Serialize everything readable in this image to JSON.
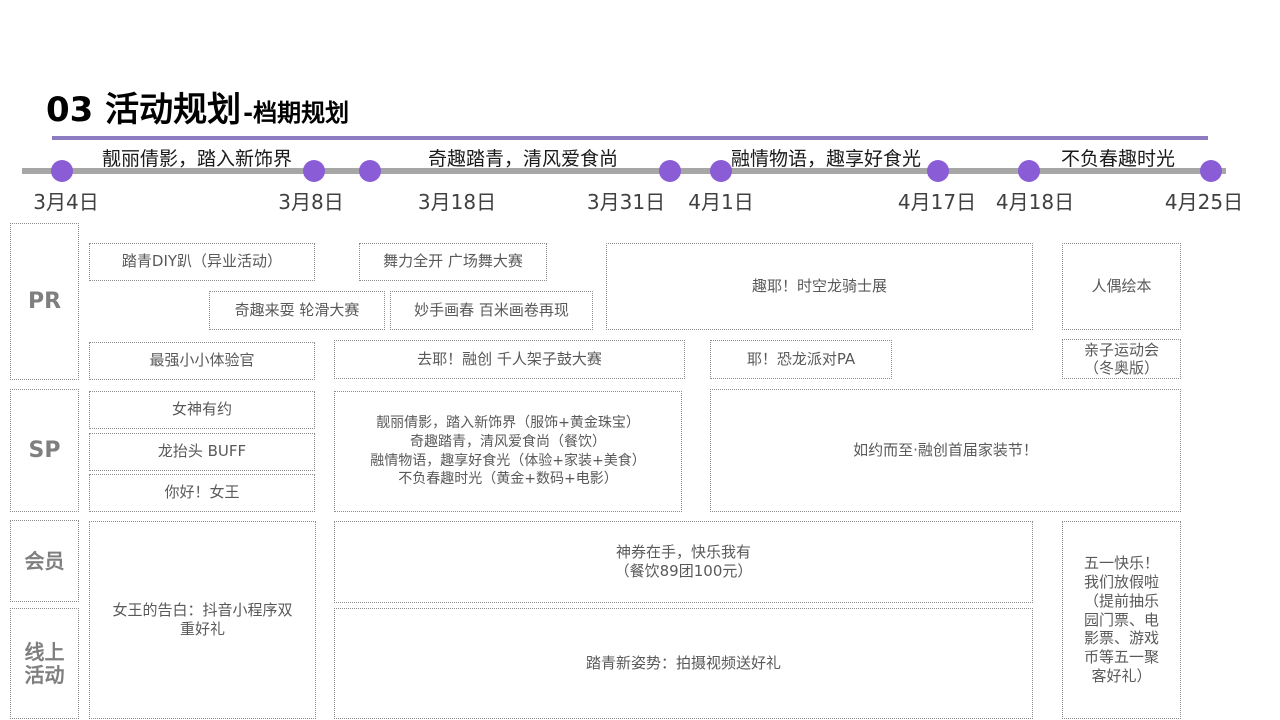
{
  "title": {
    "main": "03 活动规划",
    "sub": "-档期规划"
  },
  "timeline": {
    "phases": [
      "靓丽倩影，踏入新饰界",
      "奇趣踏青，清风爱食尚",
      "融情物语，趣享好食光",
      "不负春趣时光"
    ],
    "dates": [
      "3月4日",
      "3月8日",
      "3月18日",
      "3月31日",
      "4月1日",
      "4月17日",
      "4月18日",
      "4月25日"
    ]
  },
  "rows": {
    "pr": "PR",
    "sp": "SP",
    "member": "会员",
    "online": "线上\n活动"
  },
  "pr": {
    "diy": "踏青DIY趴（异业活动）",
    "dance": "舞力全开 广场舞大赛",
    "skate": "奇趣来耍 轮滑大赛",
    "scroll": "妙手画春 百米画卷再现",
    "knight": "趣耶！时空龙骑士展",
    "puppet": "人偶绘本",
    "experience": "最强小小体验官",
    "drum": "去耶！融创 千人架子鼓大赛",
    "dino": "耶！恐龙派对PA",
    "parent": "亲子运动会\n（冬奥版）"
  },
  "sp": {
    "goddess": "女神有约",
    "buff": "龙抬头 BUFF",
    "hello": "你好！女王",
    "themes": "靓丽倩影，踏入新饰界（服饰+黄金珠宝）\n奇趣踏青，清风爱食尚（餐饮）\n融情物语，趣享好食光（体验+家装+美食）\n不负春趣时光（黄金+数码+电影）",
    "home": "如约而至·融创首届家装节！"
  },
  "member": {
    "coupon": "神券在手，快乐我有\n（餐饮89团100元）",
    "queen": "女王的告白：抖音小程序双\n重好礼",
    "mayday": "五一快乐！\n我们放假啦\n（提前抽乐\n园门票、电\n影票、游戏\n币等五一聚\n客好礼）"
  },
  "online": {
    "video": "踏青新姿势：拍摄视频送好礼"
  },
  "colors": {
    "accent": "#8a5cd6",
    "rule": "#8e7cc3",
    "timeline": "#a6a6a6"
  }
}
